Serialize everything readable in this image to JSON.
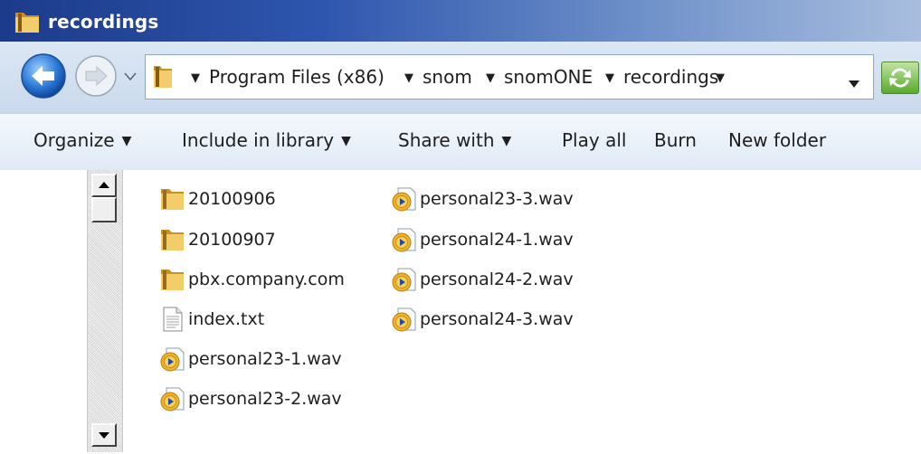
{
  "window": {
    "title": "recordings"
  },
  "address": {
    "crumbs": [
      "Program Files (x86)",
      "snom",
      "snomONE",
      "recordings"
    ]
  },
  "commands": {
    "organize": "Organize",
    "include_in_library": "Include in library",
    "share_with": "Share with",
    "play_all": "Play all",
    "burn": "Burn",
    "new_folder": "New folder"
  },
  "files": [
    {
      "name": "20100906",
      "type": "folder"
    },
    {
      "name": "20100907",
      "type": "folder"
    },
    {
      "name": "pbx.company.com",
      "type": "folder"
    },
    {
      "name": "index.txt",
      "type": "text"
    },
    {
      "name": "personal23-1.wav",
      "type": "audio"
    },
    {
      "name": "personal23-2.wav",
      "type": "audio"
    },
    {
      "name": "personal23-3.wav",
      "type": "audio"
    },
    {
      "name": "personal24-1.wav",
      "type": "audio"
    },
    {
      "name": "personal24-2.wav",
      "type": "audio"
    },
    {
      "name": "personal24-3.wav",
      "type": "audio"
    }
  ],
  "colors": {
    "title_bar": "#1c3b8a",
    "command_bar": "#dfe9f5",
    "folder": "#e8b84a"
  },
  "icons": {
    "title": "folder-icon",
    "back": "back-arrow-icon",
    "forward": "forward-arrow-icon",
    "refresh": "refresh-icon"
  }
}
